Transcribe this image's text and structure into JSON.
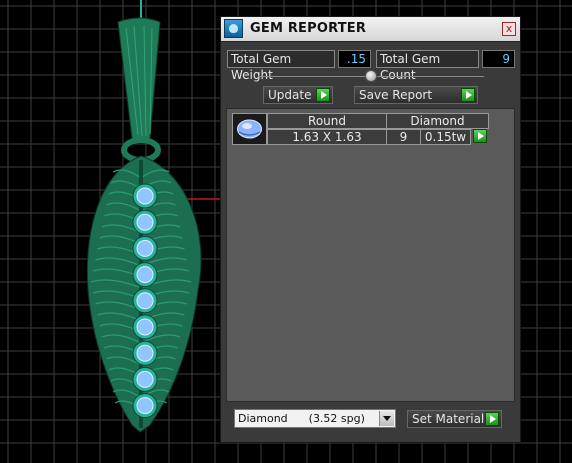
{
  "panel": {
    "title": "GEM REPORTER",
    "close_label": "x",
    "total_gem_weight_label": "Total Gem Weight",
    "total_gem_weight_value": ".15",
    "total_gem_count_label": "Total Gem Count",
    "total_gem_count_value": "9",
    "update_label": "Update",
    "save_report_label": "Save Report",
    "slider_value": 0.5
  },
  "gem_table": {
    "shape": "Round",
    "material": "Diamond",
    "size": "1.63 X 1.63",
    "count": "9",
    "weight": "0.15tw"
  },
  "material_select": {
    "selected": "Diamond      (3.52 spg)"
  },
  "set_material_label": "Set Material",
  "colors": {
    "panel_bg": "#3a3a3a",
    "viewport_bg": "#000000",
    "grid": "#3c3c3c",
    "model": "#1f7a55",
    "gem": "#8fc6ff",
    "value_text": "#5fd0ff",
    "accent_green": "#3cbf3c"
  }
}
